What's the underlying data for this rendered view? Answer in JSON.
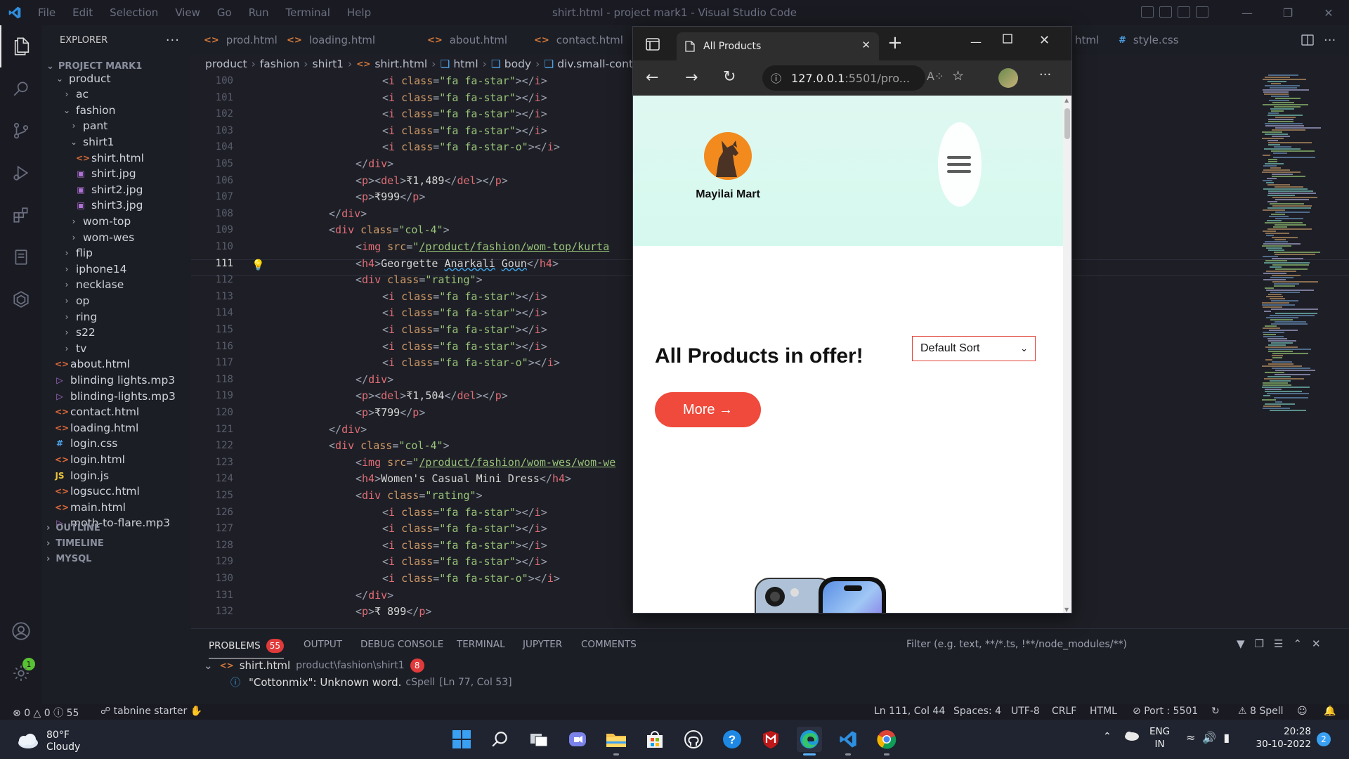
{
  "titlebar": {
    "menu": [
      "File",
      "Edit",
      "Selection",
      "View",
      "Go",
      "Run",
      "Terminal",
      "Help"
    ],
    "title": "shirt.html - project mark1 - Visual Studio Code"
  },
  "sidebar": {
    "header": "EXPLORER",
    "project": "PROJECT MARK1",
    "tree": [
      {
        "label": "product",
        "type": "folder",
        "open": true,
        "depth": 1
      },
      {
        "label": "ac",
        "type": "folder",
        "open": false,
        "depth": 2
      },
      {
        "label": "fashion",
        "type": "folder",
        "open": true,
        "depth": 2
      },
      {
        "label": "pant",
        "type": "folder",
        "open": false,
        "depth": 3
      },
      {
        "label": "shirt1",
        "type": "folder",
        "open": true,
        "depth": 3
      },
      {
        "label": "shirt.html",
        "type": "html",
        "depth": 4
      },
      {
        "label": "shirt.jpg",
        "type": "img",
        "depth": 4
      },
      {
        "label": "shirt2.jpg",
        "type": "img",
        "depth": 4
      },
      {
        "label": "shirt3.jpg",
        "type": "img",
        "depth": 4
      },
      {
        "label": "wom-top",
        "type": "folder",
        "open": false,
        "depth": 3
      },
      {
        "label": "wom-wes",
        "type": "folder",
        "open": false,
        "depth": 3
      },
      {
        "label": "flip",
        "type": "folder",
        "open": false,
        "depth": 2
      },
      {
        "label": "iphone14",
        "type": "folder",
        "open": false,
        "depth": 2
      },
      {
        "label": "necklase",
        "type": "folder",
        "open": false,
        "depth": 2
      },
      {
        "label": "op",
        "type": "folder",
        "open": false,
        "depth": 2
      },
      {
        "label": "ring",
        "type": "folder",
        "open": false,
        "depth": 2
      },
      {
        "label": "s22",
        "type": "folder",
        "open": false,
        "depth": 2
      },
      {
        "label": "tv",
        "type": "folder",
        "open": false,
        "depth": 2
      },
      {
        "label": "about.html",
        "type": "html",
        "depth": 1
      },
      {
        "label": "blinding lights.mp3",
        "type": "audio",
        "depth": 1
      },
      {
        "label": "blinding-lights.mp3",
        "type": "audio",
        "depth": 1
      },
      {
        "label": "contact.html",
        "type": "html",
        "depth": 1
      },
      {
        "label": "loading.html",
        "type": "html",
        "depth": 1
      },
      {
        "label": "login.css",
        "type": "css",
        "depth": 1
      },
      {
        "label": "login.html",
        "type": "html",
        "depth": 1
      },
      {
        "label": "login.js",
        "type": "js",
        "depth": 1
      },
      {
        "label": "logsucc.html",
        "type": "html",
        "depth": 1
      },
      {
        "label": "main.html",
        "type": "html",
        "depth": 1
      },
      {
        "label": "moth-to-flare.mp3",
        "type": "audio",
        "depth": 1
      }
    ],
    "sections": [
      "OUTLINE",
      "TIMELINE",
      "MYSQL"
    ],
    "accounts_badge": "1"
  },
  "tabs": [
    "prod.html",
    "loading.html",
    "about.html",
    "contact.html",
    "html",
    "style.css"
  ],
  "breadcrumb": [
    "product",
    "fashion",
    "shirt1",
    "shirt.html",
    "html",
    "body",
    "div.small-conta"
  ],
  "editor": {
    "current_line": "111",
    "lines": [
      {
        "n": "100",
        "indent": 8,
        "html": "<span class='pn'>&lt;</span><span class='tg'>i</span> <span class='at'>class</span><span class='pn'>=</span><span class='st'>\"fa fa-star\"</span><span class='pn'>&gt;&lt;/</span><span class='tg'>i</span><span class='pn'>&gt;</span>"
      },
      {
        "n": "101",
        "indent": 8,
        "html": "<span class='pn'>&lt;</span><span class='tg'>i</span> <span class='at'>class</span><span class='pn'>=</span><span class='st'>\"fa fa-star\"</span><span class='pn'>&gt;&lt;/</span><span class='tg'>i</span><span class='pn'>&gt;</span>"
      },
      {
        "n": "102",
        "indent": 8,
        "html": "<span class='pn'>&lt;</span><span class='tg'>i</span> <span class='at'>class</span><span class='pn'>=</span><span class='st'>\"fa fa-star\"</span><span class='pn'>&gt;&lt;/</span><span class='tg'>i</span><span class='pn'>&gt;</span>"
      },
      {
        "n": "103",
        "indent": 8,
        "html": "<span class='pn'>&lt;</span><span class='tg'>i</span> <span class='at'>class</span><span class='pn'>=</span><span class='st'>\"fa fa-star\"</span><span class='pn'>&gt;&lt;/</span><span class='tg'>i</span><span class='pn'>&gt;</span>"
      },
      {
        "n": "104",
        "indent": 8,
        "html": "<span class='pn'>&lt;</span><span class='tg'>i</span> <span class='at'>class</span><span class='pn'>=</span><span class='st'>\"fa fa-star-o\"</span><span class='pn'>&gt;&lt;/</span><span class='tg'>i</span><span class='pn'>&gt;</span>"
      },
      {
        "n": "105",
        "indent": 6,
        "html": "<span class='pn'>&lt;/</span><span class='tg'>div</span><span class='pn'>&gt;</span>"
      },
      {
        "n": "106",
        "indent": 6,
        "html": "<span class='pn'>&lt;</span><span class='tg'>p</span><span class='pn'>&gt;&lt;</span><span class='tg'>del</span><span class='pn'>&gt;</span>₹1,489<span class='pn'>&lt;/</span><span class='tg'>del</span><span class='pn'>&gt;&lt;/</span><span class='tg'>p</span><span class='pn'>&gt;</span>"
      },
      {
        "n": "107",
        "indent": 6,
        "html": "<span class='pn'>&lt;</span><span class='tg'>p</span><span class='pn'>&gt;</span>₹999<span class='pn'>&lt;/</span><span class='tg'>p</span><span class='pn'>&gt;</span>"
      },
      {
        "n": "108",
        "indent": 4,
        "html": "<span class='pn'>&lt;/</span><span class='tg'>div</span><span class='pn'>&gt;</span>"
      },
      {
        "n": "109",
        "indent": 4,
        "html": "<span class='pn'>&lt;</span><span class='tg'>div</span> <span class='at'>class</span><span class='pn'>=</span><span class='st'>\"col-4\"</span><span class='pn'>&gt;</span>"
      },
      {
        "n": "110",
        "indent": 6,
        "html": "<span class='pn'>&lt;</span><span class='tg'>img</span> <span class='at'>src</span><span class='pn'>=</span><span class='st'>\"</span><span class='lk'>/product/fashion/wom-top/kurta</span>"
      },
      {
        "n": "111",
        "indent": 6,
        "html": "<span class='pn'>&lt;</span><span class='tg'>h4</span><span class='pn'>&gt;</span>Georgette <span class='sq'>Anarkali</span> <span class='sq'>Goun</span><span class='pn'>&lt;/</span><span class='tg'>h4</span><span class='pn'>&gt;</span>"
      },
      {
        "n": "112",
        "indent": 6,
        "html": "<span class='pn'>&lt;</span><span class='tg'>div</span> <span class='at'>class</span><span class='pn'>=</span><span class='st'>\"rating\"</span><span class='pn'>&gt;</span>"
      },
      {
        "n": "113",
        "indent": 8,
        "html": "<span class='pn'>&lt;</span><span class='tg'>i</span> <span class='at'>class</span><span class='pn'>=</span><span class='st'>\"fa fa-star\"</span><span class='pn'>&gt;&lt;/</span><span class='tg'>i</span><span class='pn'>&gt;</span>"
      },
      {
        "n": "114",
        "indent": 8,
        "html": "<span class='pn'>&lt;</span><span class='tg'>i</span> <span class='at'>class</span><span class='pn'>=</span><span class='st'>\"fa fa-star\"</span><span class='pn'>&gt;&lt;/</span><span class='tg'>i</span><span class='pn'>&gt;</span>"
      },
      {
        "n": "115",
        "indent": 8,
        "html": "<span class='pn'>&lt;</span><span class='tg'>i</span> <span class='at'>class</span><span class='pn'>=</span><span class='st'>\"fa fa-star\"</span><span class='pn'>&gt;&lt;/</span><span class='tg'>i</span><span class='pn'>&gt;</span>"
      },
      {
        "n": "116",
        "indent": 8,
        "html": "<span class='pn'>&lt;</span><span class='tg'>i</span> <span class='at'>class</span><span class='pn'>=</span><span class='st'>\"fa fa-star\"</span><span class='pn'>&gt;&lt;/</span><span class='tg'>i</span><span class='pn'>&gt;</span>"
      },
      {
        "n": "117",
        "indent": 8,
        "html": "<span class='pn'>&lt;</span><span class='tg'>i</span> <span class='at'>class</span><span class='pn'>=</span><span class='st'>\"fa fa-star-o\"</span><span class='pn'>&gt;&lt;/</span><span class='tg'>i</span><span class='pn'>&gt;</span>"
      },
      {
        "n": "118",
        "indent": 6,
        "html": "<span class='pn'>&lt;/</span><span class='tg'>div</span><span class='pn'>&gt;</span>"
      },
      {
        "n": "119",
        "indent": 6,
        "html": "<span class='pn'>&lt;</span><span class='tg'>p</span><span class='pn'>&gt;&lt;</span><span class='tg'>del</span><span class='pn'>&gt;</span>₹1,504<span class='pn'>&lt;/</span><span class='tg'>del</span><span class='pn'>&gt;&lt;/</span><span class='tg'>p</span><span class='pn'>&gt;</span>"
      },
      {
        "n": "120",
        "indent": 6,
        "html": "<span class='pn'>&lt;</span><span class='tg'>p</span><span class='pn'>&gt;</span>₹799<span class='pn'>&lt;/</span><span class='tg'>p</span><span class='pn'>&gt;</span>"
      },
      {
        "n": "121",
        "indent": 4,
        "html": "<span class='pn'>&lt;/</span><span class='tg'>div</span><span class='pn'>&gt;</span>"
      },
      {
        "n": "122",
        "indent": 4,
        "html": "<span class='pn'>&lt;</span><span class='tg'>div</span> <span class='at'>class</span><span class='pn'>=</span><span class='st'>\"col-4\"</span><span class='pn'>&gt;</span>"
      },
      {
        "n": "123",
        "indent": 6,
        "html": "<span class='pn'>&lt;</span><span class='tg'>img</span> <span class='at'>src</span><span class='pn'>=</span><span class='st'>\"</span><span class='lk'>/product/fashion/wom-wes/wom-we</span>"
      },
      {
        "n": "124",
        "indent": 6,
        "html": "<span class='pn'>&lt;</span><span class='tg'>h4</span><span class='pn'>&gt;</span>Women's Casual Mini Dress<span class='pn'>&lt;/</span><span class='tg'>h4</span><span class='pn'>&gt;</span>"
      },
      {
        "n": "125",
        "indent": 6,
        "html": "<span class='pn'>&lt;</span><span class='tg'>div</span> <span class='at'>class</span><span class='pn'>=</span><span class='st'>\"rating\"</span><span class='pn'>&gt;</span>"
      },
      {
        "n": "126",
        "indent": 8,
        "html": "<span class='pn'>&lt;</span><span class='tg'>i</span> <span class='at'>class</span><span class='pn'>=</span><span class='st'>\"fa fa-star\"</span><span class='pn'>&gt;&lt;/</span><span class='tg'>i</span><span class='pn'>&gt;</span>"
      },
      {
        "n": "127",
        "indent": 8,
        "html": "<span class='pn'>&lt;</span><span class='tg'>i</span> <span class='at'>class</span><span class='pn'>=</span><span class='st'>\"fa fa-star\"</span><span class='pn'>&gt;&lt;/</span><span class='tg'>i</span><span class='pn'>&gt;</span>"
      },
      {
        "n": "128",
        "indent": 8,
        "html": "<span class='pn'>&lt;</span><span class='tg'>i</span> <span class='at'>class</span><span class='pn'>=</span><span class='st'>\"fa fa-star\"</span><span class='pn'>&gt;&lt;/</span><span class='tg'>i</span><span class='pn'>&gt;</span>"
      },
      {
        "n": "129",
        "indent": 8,
        "html": "<span class='pn'>&lt;</span><span class='tg'>i</span> <span class='at'>class</span><span class='pn'>=</span><span class='st'>\"fa fa-star\"</span><span class='pn'>&gt;&lt;/</span><span class='tg'>i</span><span class='pn'>&gt;</span>"
      },
      {
        "n": "130",
        "indent": 8,
        "html": "<span class='pn'>&lt;</span><span class='tg'>i</span> <span class='at'>class</span><span class='pn'>=</span><span class='st'>\"fa fa-star-o\"</span><span class='pn'>&gt;&lt;/</span><span class='tg'>i</span><span class='pn'>&gt;</span>"
      },
      {
        "n": "131",
        "indent": 6,
        "html": "<span class='pn'>&lt;/</span><span class='tg'>div</span><span class='pn'>&gt;</span>"
      },
      {
        "n": "132",
        "indent": 6,
        "html": "<span class='pn'>&lt;</span><span class='tg'>p</span><span class='pn'>&gt;</span>₹ 899<span class='pn'>&lt;/</span><span class='tg'>p</span><span class='pn'>&gt;</span>"
      }
    ]
  },
  "panel": {
    "tabs": [
      "PROBLEMS",
      "OUTPUT",
      "DEBUG CONSOLE",
      "TERMINAL",
      "JUPYTER",
      "COMMENTS"
    ],
    "problems_count": "55",
    "filter_placeholder": "Filter (e.g. text, **/*.ts, !**/node_modules/**)",
    "file": "shirt.html",
    "file_path": "product\\fashion\\shirt1",
    "file_count": "8",
    "message": "\"Cottonmix\": Unknown word.",
    "message_source": "cSpell",
    "message_loc": "[Ln 77, Col 53]"
  },
  "statusbar": {
    "errors": "0",
    "warnings": "0",
    "infos": "55",
    "tabnine": "tabnine starter",
    "position": "Ln 111, Col 44",
    "spaces": "Spaces: 4",
    "encoding": "UTF-8",
    "eol": "CRLF",
    "language": "HTML",
    "port": "Port : 5501",
    "spell": "8 Spell"
  },
  "browser": {
    "tab_title": "All Products",
    "url_host": "127.0.0.1",
    "url_rest": ":5501/pro...",
    "brand": "Mayilai Mart",
    "heading": "All Products in offer!",
    "sort_value": "Default Sort",
    "more_label": "More →"
  },
  "taskbar": {
    "weather_temp": "80°F",
    "weather_desc": "Cloudy",
    "lang_line1": "ENG",
    "lang_line2": "IN",
    "time": "20:28",
    "date": "30-10-2022",
    "notif_count": "2"
  },
  "colors": {
    "vscode_bg": "#1e1f26",
    "accent_red": "#ef4a3c",
    "hero_bg": "#dff8f1"
  }
}
